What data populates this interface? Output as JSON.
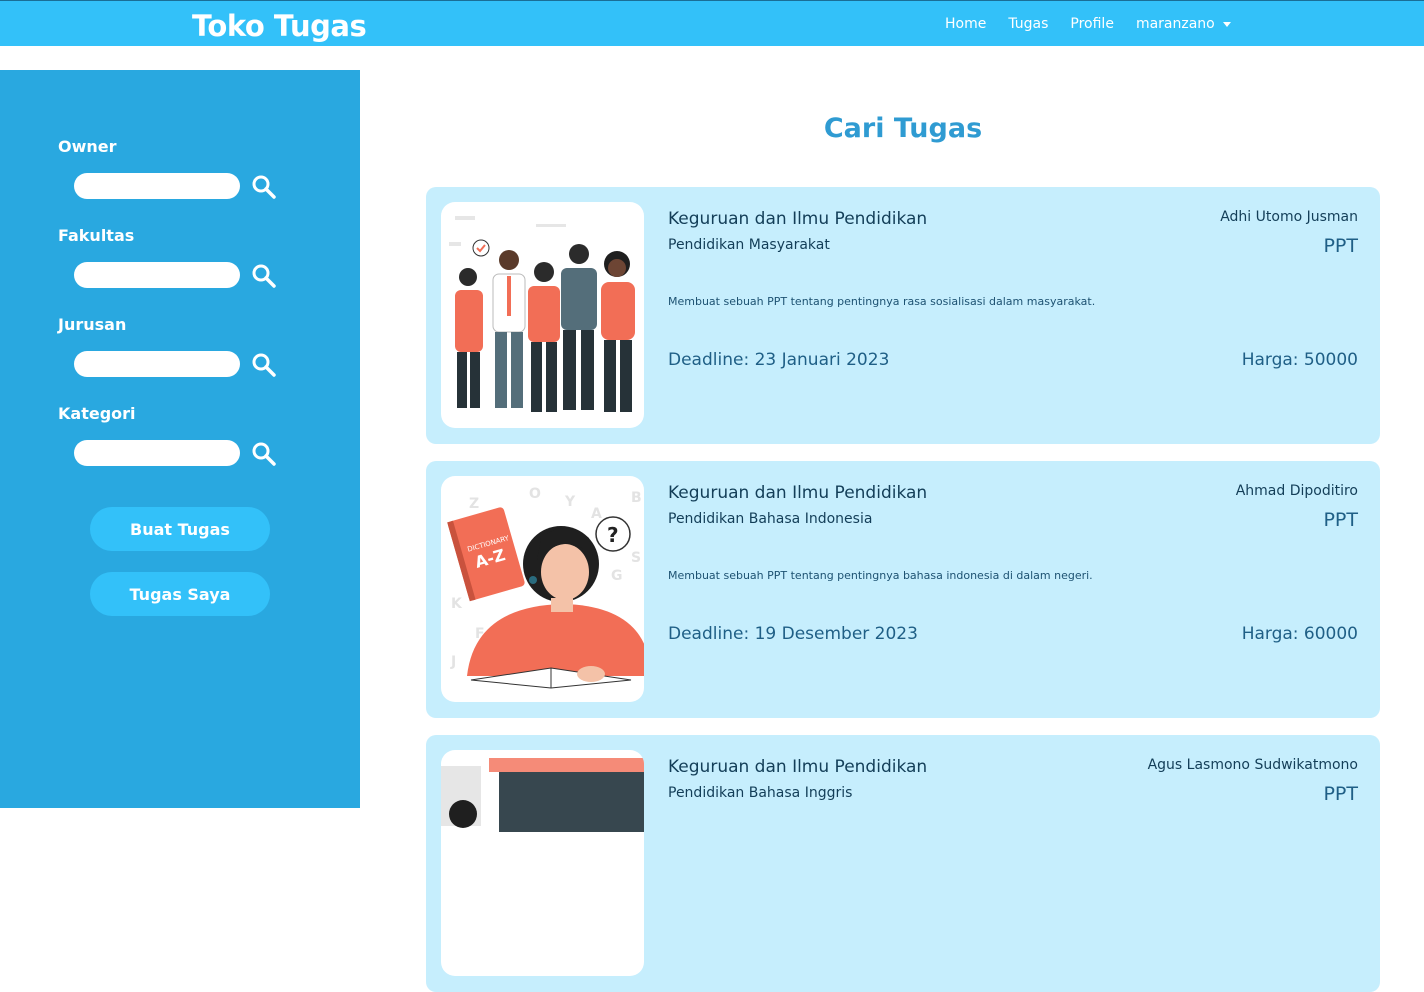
{
  "navbar": {
    "brand": "Toko Tugas",
    "links": [
      "Home",
      "Tugas",
      "Profile"
    ],
    "user": "maranzano"
  },
  "sidebar": {
    "filters": [
      {
        "label": "Owner",
        "value": ""
      },
      {
        "label": "Fakultas",
        "value": ""
      },
      {
        "label": "Jurusan",
        "value": ""
      },
      {
        "label": "Kategori",
        "value": ""
      }
    ],
    "buttons": {
      "create": "Buat Tugas",
      "mine": "Tugas Saya"
    }
  },
  "main": {
    "title": "Cari Tugas",
    "cards": [
      {
        "faculty": "Keguruan dan Ilmu Pendidikan",
        "major": "Pendidikan Masyarakat",
        "description": "Membuat sebuah PPT tentang pentingnya rasa sosialisasi dalam masyarakat.",
        "deadline": "Deadline: 23 Januari 2023",
        "owner": "Adhi Utomo Jusman",
        "category": "PPT",
        "price": "Harga: 50000"
      },
      {
        "faculty": "Keguruan dan Ilmu Pendidikan",
        "major": "Pendidikan Bahasa Indonesia",
        "description": "Membuat sebuah PPT tentang pentingnya bahasa indonesia di dalam negeri.",
        "deadline": "Deadline: 19 Desember 2023",
        "owner": "Ahmad Dipoditiro",
        "category": "PPT",
        "price": "Harga: 60000"
      },
      {
        "faculty": "Keguruan dan Ilmu Pendidikan",
        "major": "Pendidikan Bahasa Inggris",
        "description": "",
        "deadline": "",
        "owner": "Agus Lasmono Sudwikatmono",
        "category": "PPT",
        "price": ""
      }
    ],
    "illustrations": {
      "card_1": "people-group-illustration",
      "card_2": "reading-dictionary-illustration",
      "card_3": "classroom-illustration"
    }
  },
  "colors": {
    "navbar": "#33c1f9",
    "sidebar": "#29a8e0",
    "card": "#c6eefd",
    "title": "#2f9bd2",
    "accent_illustration": "#f26e56"
  }
}
